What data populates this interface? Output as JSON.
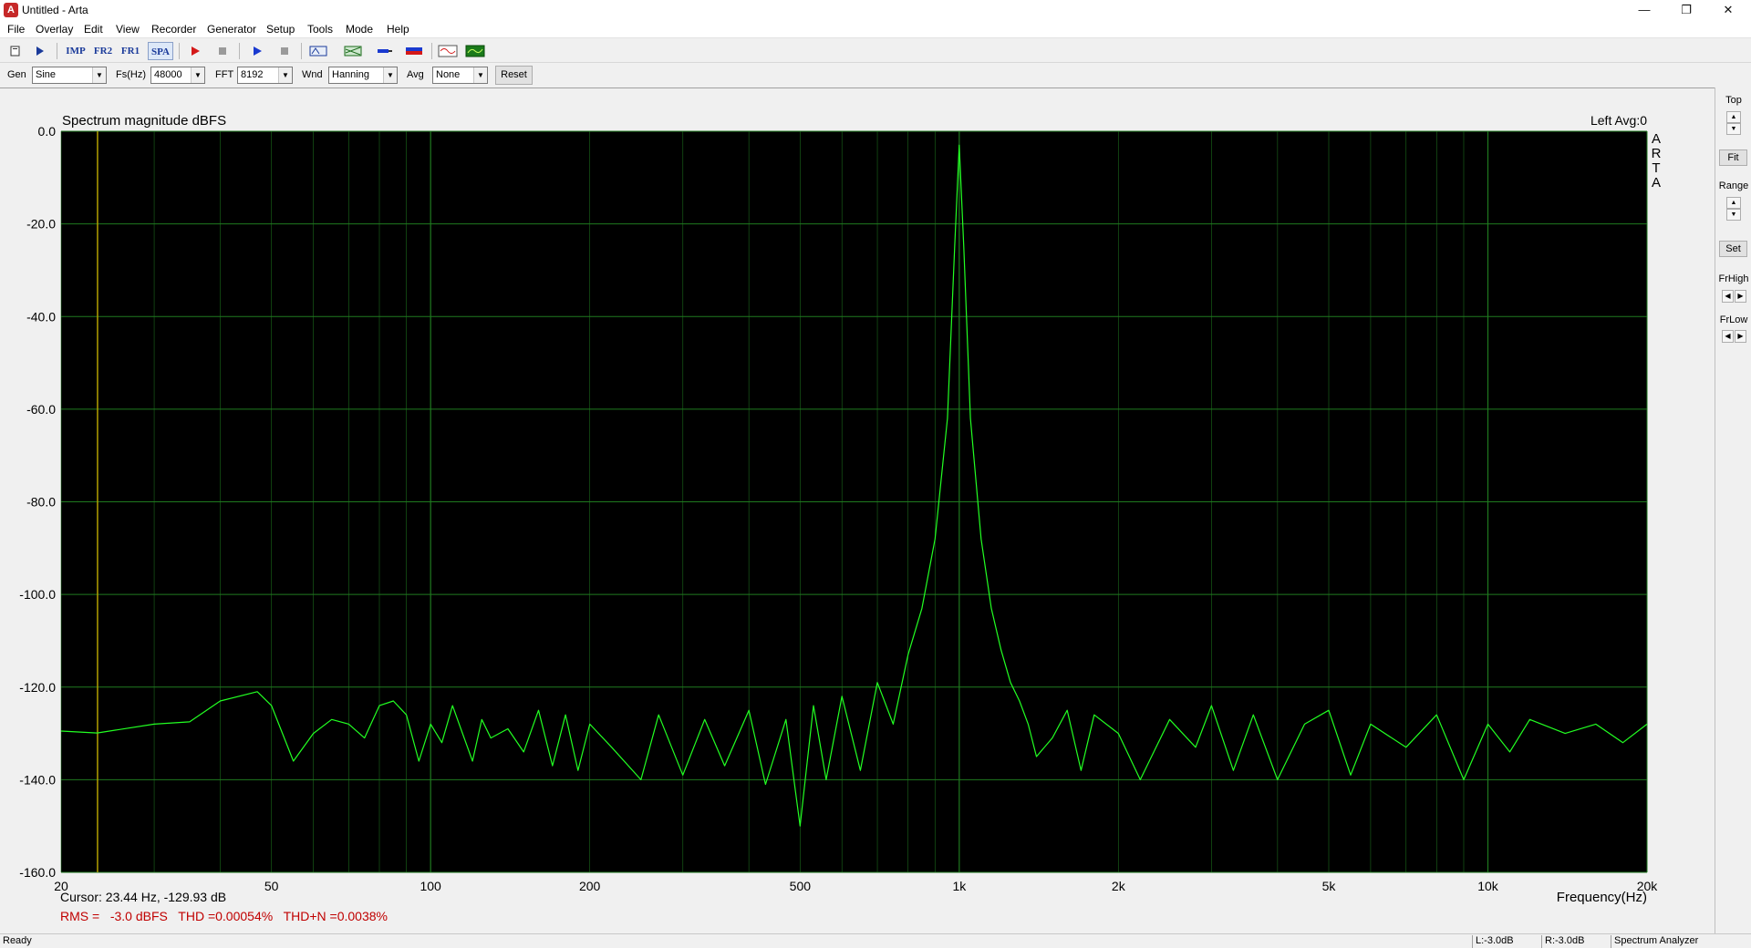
{
  "window": {
    "title": "Untitled - Arta",
    "icon": "arta-app-icon"
  },
  "menu": [
    "File",
    "Overlay",
    "Edit",
    "View",
    "Recorder",
    "Generator",
    "Setup",
    "Tools",
    "Mode",
    "Help"
  ],
  "toolbar": {
    "imp_label": "IMP",
    "fr2_label": "FR2",
    "fr1_label": "FR1",
    "spa_label": "SPA",
    "icons": [
      "new-icon",
      "open-icon",
      "imp-mode-icon",
      "fr2-mode-icon",
      "fr1-mode-icon",
      "spa-mode-icon",
      "record-icon",
      "stop-icon",
      "play-icon",
      "stop-playback-icon",
      "fft-abc-icon",
      "spectrum-icon",
      "probe-icon",
      "bar-icon",
      "signal-icon",
      "scope-icon"
    ]
  },
  "controls": {
    "gen_label": "Gen",
    "gen_value": "Sine",
    "fs_label": "Fs(Hz)",
    "fs_value": "48000",
    "fft_label": "FFT",
    "fft_value": "8192",
    "wnd_label": "Wnd",
    "wnd_value": "Hanning",
    "avg_label": "Avg",
    "avg_value": "None",
    "reset_label": "Reset"
  },
  "plot": {
    "title": "Spectrum magnitude dBFS",
    "channel_info": "Left  Avg:0",
    "brand_letters": [
      "A",
      "R",
      "T",
      "A"
    ],
    "cursor_text": "Cursor: 23.44 Hz, -129.93 dB",
    "measurements": "RMS =   -3.0 dBFS   THD =0.00054%   THD+N =0.0038%",
    "xlabel": "Frequency(Hz)",
    "background": "#000000",
    "grid_color": "#1f7a1f",
    "trace_color": "#22ff22",
    "cursor_color": "#b3a000",
    "measure_color": "#c00000"
  },
  "chart_data": {
    "type": "line",
    "title": "Spectrum magnitude dBFS",
    "xlabel": "Frequency(Hz)",
    "ylabel": "",
    "x_scale": "log",
    "xlim": [
      20,
      20000
    ],
    "ylim": [
      -160,
      0
    ],
    "grid": true,
    "x_ticks": [
      20,
      50,
      100,
      200,
      500,
      1000,
      2000,
      5000,
      10000,
      20000
    ],
    "x_tick_labels": [
      "20",
      "50",
      "100",
      "200",
      "500",
      "1k",
      "2k",
      "5k",
      "10k",
      "20k"
    ],
    "y_ticks": [
      0,
      -20,
      -40,
      -60,
      -80,
      -100,
      -120,
      -140,
      -160
    ],
    "y_tick_labels": [
      "0.0",
      "-20.0",
      "-40.0",
      "-60.0",
      "-80.0",
      "-100.0",
      "-120.0",
      "-140.0",
      "-160.0"
    ],
    "cursor": {
      "freq_hz": 23.44,
      "level_db": -129.93
    },
    "series": [
      {
        "x": [
          20,
          23.4,
          30,
          35,
          40,
          47,
          50,
          55,
          60,
          65,
          70,
          75,
          80,
          85,
          90,
          95,
          100,
          105,
          110,
          120,
          125,
          130,
          140,
          150,
          160,
          170,
          180,
          190,
          200,
          220,
          250,
          270,
          300,
          330,
          360,
          400,
          430,
          470,
          500,
          530,
          560,
          600,
          650,
          700,
          750,
          800,
          850,
          900,
          950,
          980,
          1000,
          1020,
          1050,
          1100,
          1150,
          1200,
          1250,
          1300,
          1350,
          1400,
          1500,
          1600,
          1700,
          1800,
          2000,
          2200,
          2500,
          2800,
          3000,
          3300,
          3600,
          4000,
          4500,
          5000,
          5500,
          6000,
          7000,
          8000,
          9000,
          10000,
          11000,
          12000,
          14000,
          16000,
          18000,
          20000
        ],
        "y": [
          -129.5,
          -129.9,
          -128,
          -127.5,
          -123,
          -121,
          -124,
          -136,
          -130,
          -127,
          -128,
          -131,
          -124,
          -123,
          -126,
          -136,
          -128,
          -132,
          -124,
          -136,
          -127,
          -131,
          -129,
          -134,
          -125,
          -137,
          -126,
          -138,
          -128,
          -133,
          -140,
          -126,
          -139,
          -127,
          -137,
          -125,
          -141,
          -127,
          -150,
          -124,
          -140,
          -122,
          -138,
          -119,
          -128,
          -113,
          -103,
          -88,
          -62,
          -25,
          -3,
          -25,
          -62,
          -88,
          -103,
          -112,
          -119,
          -123,
          -128,
          -135,
          -131,
          -125,
          -138,
          -126,
          -130,
          -140,
          -127,
          -133,
          -124,
          -138,
          -126,
          -140,
          -128,
          -125,
          -139,
          -128,
          -133,
          -126,
          -140,
          -128,
          -134,
          -127,
          -130,
          -128,
          -132,
          -128
        ]
      }
    ]
  },
  "right_panel": {
    "top_label": "Top",
    "fit_label": "Fit",
    "range_label": "Range",
    "set_label": "Set",
    "frhigh_label": "FrHigh",
    "frlow_label": "FrLow"
  },
  "status": {
    "ready": "Ready",
    "left_level": "L:-3.0dB",
    "right_level": "R:-3.0dB",
    "mode": "Spectrum Analyzer"
  }
}
